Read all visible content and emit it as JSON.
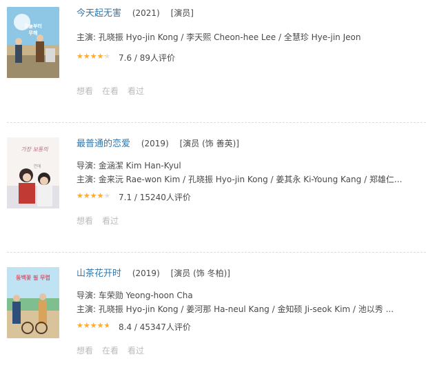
{
  "items": [
    {
      "title": "今天起无害",
      "year": "(2021)",
      "role": "[演员]",
      "director": "",
      "cast": "主演: 孔晓振 Hyo-jin Kong / 李天熙 Cheon-hee Lee / 全慧珍 Hye-jin Jeon",
      "rating_fraction": 0.76,
      "rating_text": "7.6 / 89人评价",
      "actions": [
        "想看",
        "在看",
        "看过"
      ],
      "poster_text": "오늘부터 무해"
    },
    {
      "title": "最普通的恋爱",
      "year": "(2019)",
      "role": "[演员 (饰 善英)]",
      "director": "导演: 金涵潔 Kim Han-Kyul",
      "cast": "主演: 金来沅 Rae-won Kim / 孔晓振 Hyo-jin Kong / 姜其永 Ki-Young Kang / 郑雄仁...",
      "rating_fraction": 0.71,
      "rating_text": "7.1 / 15240人评价",
      "actions": [
        "想看",
        "看过"
      ],
      "poster_text": "가장 보통의 연애"
    },
    {
      "title": "山茶花开时",
      "year": "(2019)",
      "role": "[演员 (饰 冬柏)]",
      "director": "导演: 车荣勋 Yeong-hoon Cha",
      "cast": "主演: 孔晓振 Hyo-jin Kong / 姜河那 Ha-neul Kang / 金知硕 Ji-seok Kim / 池以秀 ...",
      "rating_fraction": 0.84,
      "rating_text": "8.4 / 45347人评价",
      "actions": [
        "想看",
        "在看",
        "看过"
      ],
      "poster_text": "동백꽃 필 무렵"
    }
  ],
  "colors": {
    "link": "#3377aa",
    "star": "#ffac2d",
    "muted": "#bbbbbb"
  }
}
